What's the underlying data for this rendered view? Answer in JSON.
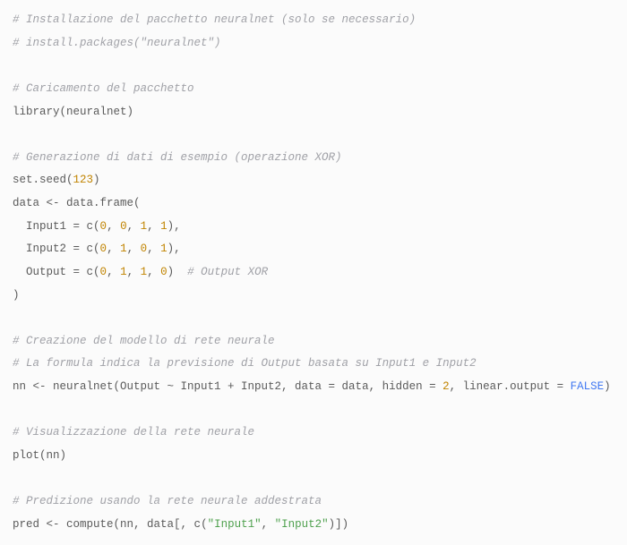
{
  "code": {
    "tokens": [
      {
        "t": "# Installazione del pacchetto neuralnet (solo se necessario)",
        "c": "cm"
      },
      {
        "t": "\n"
      },
      {
        "t": "# install.packages(\"neuralnet\")",
        "c": "cm"
      },
      {
        "t": "\n"
      },
      {
        "t": "\n"
      },
      {
        "t": "# Caricamento del pacchetto",
        "c": "cm"
      },
      {
        "t": "\n"
      },
      {
        "t": "library(neuralnet)",
        "c": "fn"
      },
      {
        "t": "\n"
      },
      {
        "t": "\n"
      },
      {
        "t": "# Generazione di dati di esempio (operazione XOR)",
        "c": "cm"
      },
      {
        "t": "\n"
      },
      {
        "t": "set.seed(",
        "c": "fn"
      },
      {
        "t": "123",
        "c": "num"
      },
      {
        "t": ")",
        "c": "fn"
      },
      {
        "t": "\n"
      },
      {
        "t": "data <- data.frame(",
        "c": "fn"
      },
      {
        "t": "\n"
      },
      {
        "t": "  Input1 = ",
        "c": "fn"
      },
      {
        "t": "c",
        "c": "fn"
      },
      {
        "t": "(",
        "c": "fn"
      },
      {
        "t": "0",
        "c": "num"
      },
      {
        "t": ", ",
        "c": "fn"
      },
      {
        "t": "0",
        "c": "num"
      },
      {
        "t": ", ",
        "c": "fn"
      },
      {
        "t": "1",
        "c": "num"
      },
      {
        "t": ", ",
        "c": "fn"
      },
      {
        "t": "1",
        "c": "num"
      },
      {
        "t": "),",
        "c": "fn"
      },
      {
        "t": "\n"
      },
      {
        "t": "  Input2 = ",
        "c": "fn"
      },
      {
        "t": "c",
        "c": "fn"
      },
      {
        "t": "(",
        "c": "fn"
      },
      {
        "t": "0",
        "c": "num"
      },
      {
        "t": ", ",
        "c": "fn"
      },
      {
        "t": "1",
        "c": "num"
      },
      {
        "t": ", ",
        "c": "fn"
      },
      {
        "t": "0",
        "c": "num"
      },
      {
        "t": ", ",
        "c": "fn"
      },
      {
        "t": "1",
        "c": "num"
      },
      {
        "t": "),",
        "c": "fn"
      },
      {
        "t": "\n"
      },
      {
        "t": "  Output = ",
        "c": "fn"
      },
      {
        "t": "c",
        "c": "fn"
      },
      {
        "t": "(",
        "c": "fn"
      },
      {
        "t": "0",
        "c": "num"
      },
      {
        "t": ", ",
        "c": "fn"
      },
      {
        "t": "1",
        "c": "num"
      },
      {
        "t": ", ",
        "c": "fn"
      },
      {
        "t": "1",
        "c": "num"
      },
      {
        "t": ", ",
        "c": "fn"
      },
      {
        "t": "0",
        "c": "num"
      },
      {
        "t": ")  ",
        "c": "fn"
      },
      {
        "t": "# Output XOR",
        "c": "cm"
      },
      {
        "t": "\n"
      },
      {
        "t": ")",
        "c": "fn"
      },
      {
        "t": "\n"
      },
      {
        "t": "\n"
      },
      {
        "t": "# Creazione del modello di rete neurale",
        "c": "cm"
      },
      {
        "t": "\n"
      },
      {
        "t": "# La formula indica la previsione di Output basata su Input1 e Input2",
        "c": "cm"
      },
      {
        "t": "\n"
      },
      {
        "t": "nn <- neuralnet(Output ~ Input1 + Input2, data = data, hidden = ",
        "c": "fn"
      },
      {
        "t": "2",
        "c": "num"
      },
      {
        "t": ", linear.output = ",
        "c": "fn"
      },
      {
        "t": "FALSE",
        "c": "kw"
      },
      {
        "t": ")",
        "c": "fn"
      },
      {
        "t": "\n"
      },
      {
        "t": "\n"
      },
      {
        "t": "# Visualizzazione della rete neurale",
        "c": "cm"
      },
      {
        "t": "\n"
      },
      {
        "t": "plot(nn)",
        "c": "fn"
      },
      {
        "t": "\n"
      },
      {
        "t": "\n"
      },
      {
        "t": "# Predizione usando la rete neurale addestrata",
        "c": "cm"
      },
      {
        "t": "\n"
      },
      {
        "t": "pred <- compute(nn, data[, ",
        "c": "fn"
      },
      {
        "t": "c",
        "c": "fn"
      },
      {
        "t": "(",
        "c": "fn"
      },
      {
        "t": "\"Input1\"",
        "c": "str"
      },
      {
        "t": ", ",
        "c": "fn"
      },
      {
        "t": "\"Input2\"",
        "c": "str"
      },
      {
        "t": ")])",
        "c": "fn"
      }
    ]
  }
}
